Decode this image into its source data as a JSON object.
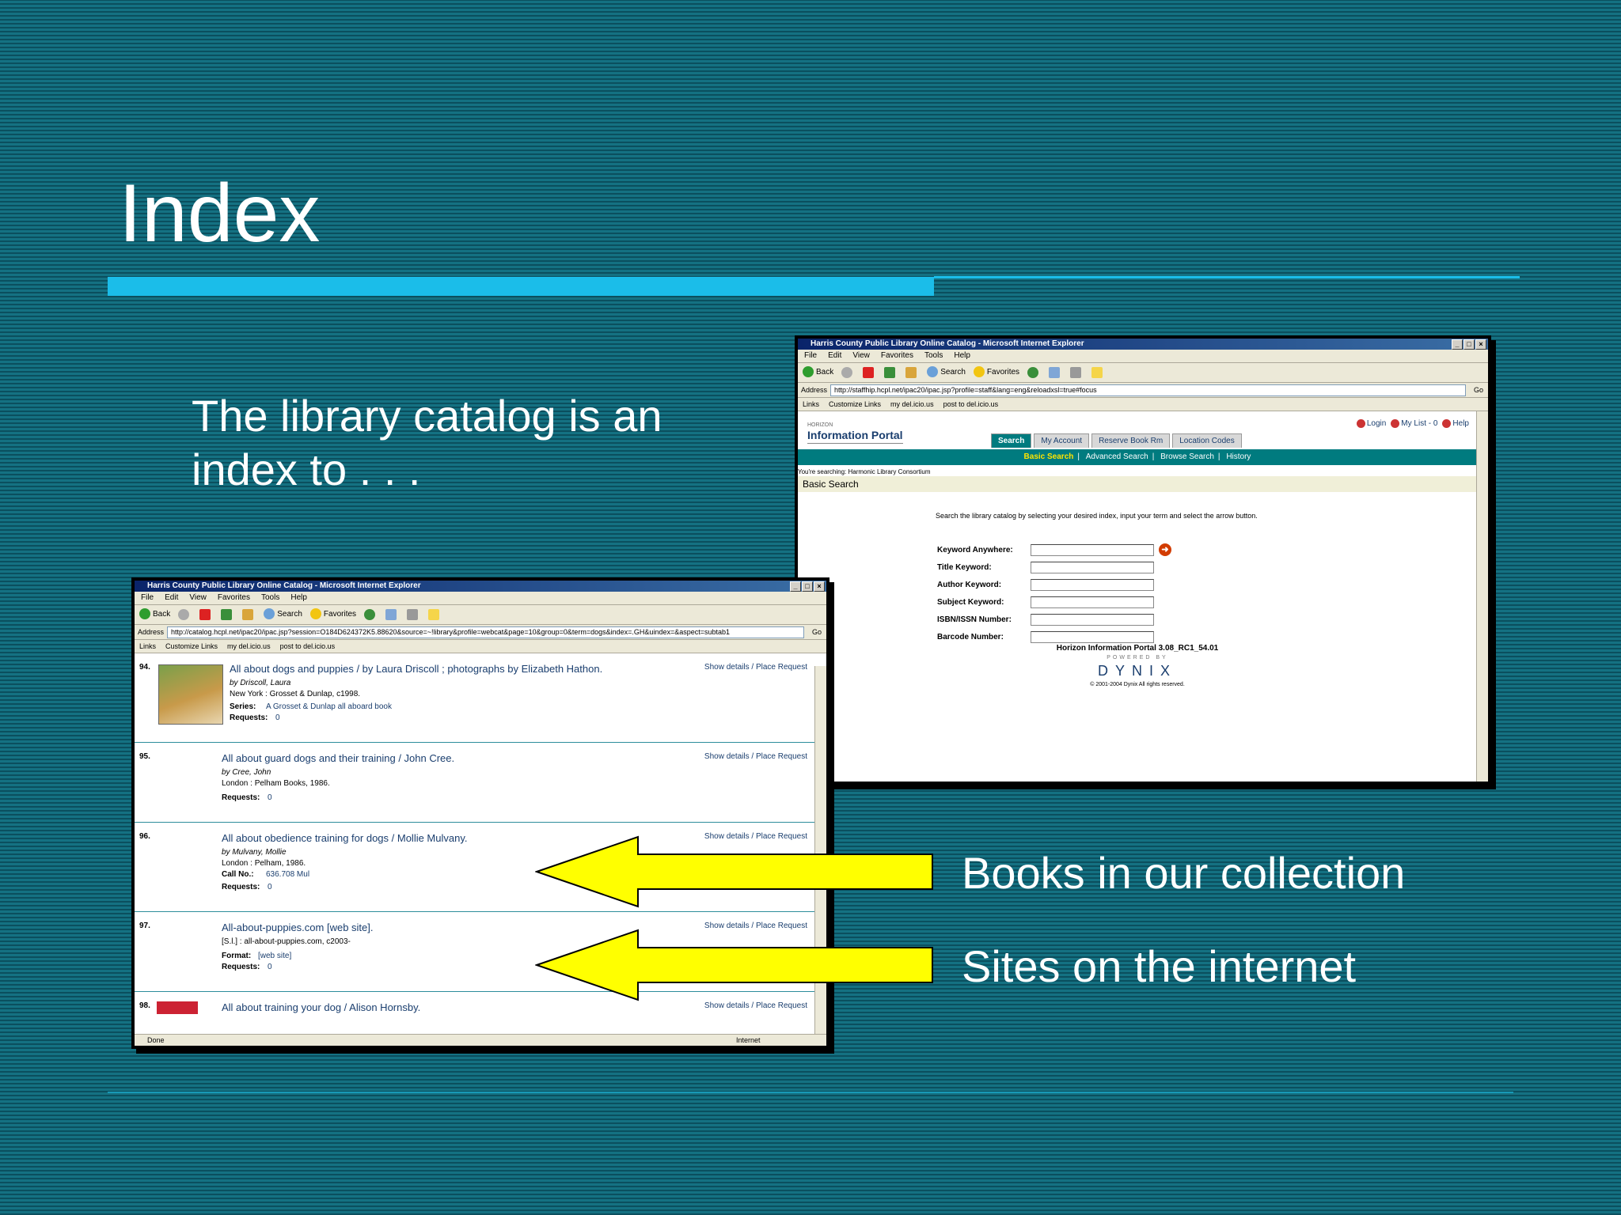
{
  "slide": {
    "title": "Index",
    "intro": "The library catalog is an index to . . .",
    "callouts": [
      "Books in our collection",
      "Sites on the internet"
    ],
    "colors": {
      "background": "#0d5b6b",
      "rule": "#1bbde9",
      "arrow": "#ffff00"
    }
  },
  "portal_window": {
    "title": "Harris County Public Library Online Catalog - Microsoft Internet Explorer",
    "menu": [
      "File",
      "Edit",
      "View",
      "Favorites",
      "Tools",
      "Help"
    ],
    "toolbar": [
      "Back",
      "Search",
      "Favorites"
    ],
    "address_label": "Address",
    "address": "http://staffhip.hcpl.net/ipac20/ipac.jsp?profile=staff&lang=eng&reloadxsl=true#focus",
    "go": "Go",
    "links_label": "Links",
    "links": [
      "Customize Links",
      "my del.icio.us",
      "post to del.icio.us"
    ],
    "logo_small": "HORIZON",
    "logo": "Information Portal",
    "top_links": [
      "Login",
      "My List - 0",
      "Help"
    ],
    "tabs": [
      "Search",
      "My Account",
      "Reserve Book Rm",
      "Location Codes"
    ],
    "subnav": [
      "Basic Search",
      "Advanced Search",
      "Browse Search",
      "History"
    ],
    "searching": "You're searching: Harmonic Library Consortium",
    "section": "Basic Search",
    "instructions": "Search the library catalog by selecting your desired index, input your term and select the arrow button.",
    "fields": [
      "Keyword Anywhere:",
      "Title Keyword:",
      "Author Keyword:",
      "Subject Keyword:",
      "ISBN/ISSN Number:",
      "Barcode Number:"
    ],
    "footer_version": "Horizon Information Portal 3.08_RC1_54.01",
    "powered": "POWERED BY",
    "brand": "DYNIX",
    "copyright": "© 2001-2004 Dynix All rights reserved."
  },
  "results_window": {
    "title": "Harris County Public Library Online Catalog - Microsoft Internet Explorer",
    "menu": [
      "File",
      "Edit",
      "View",
      "Favorites",
      "Tools",
      "Help"
    ],
    "toolbar": [
      "Back",
      "Search",
      "Favorites"
    ],
    "address_label": "Address",
    "address": "http://catalog.hcpl.net/ipac20/ipac.jsp?session=O184D624372K5.88620&source=~!library&profile=webcat&page=10&group=0&term=dogs&index=.GH&uindex=&aspect=subtab1",
    "go": "Go",
    "links_label": "Links",
    "links": [
      "Customize Links",
      "my del.icio.us",
      "post to del.icio.us"
    ],
    "actions": "Show details / Place Request",
    "status_left": "Done",
    "status_right": "Internet",
    "items": [
      {
        "num": "94.",
        "title": "All about dogs and puppies / by Laura Driscoll ; photographs by Elizabeth Hathon.",
        "by": "by Driscoll, Laura",
        "pub": "New York : Grosset & Dunlap, c1998.",
        "extra_label": "Series:",
        "extra_value": "A Grosset & Dunlap all aboard book",
        "req_label": "Requests:",
        "req_value": "0"
      },
      {
        "num": "95.",
        "title": "All about guard dogs and their training / John Cree.",
        "by": "by Cree, John",
        "pub": "London : Pelham Books, 1986.",
        "req_label": "Requests:",
        "req_value": "0"
      },
      {
        "num": "96.",
        "title": "All about obedience training for dogs / Mollie Mulvany.",
        "by": "by Mulvany, Mollie",
        "pub": "London : Pelham, 1986.",
        "extra_label": "Call No.:",
        "extra_value": "636.708 Mul",
        "req_label": "Requests:",
        "req_value": "0"
      },
      {
        "num": "97.",
        "title": "All-about-puppies.com [web site].",
        "pub": "[S.l.] : all-about-puppies.com, c2003-",
        "extra_label": "Format:",
        "extra_value": "[web site]",
        "req_label": "Requests:",
        "req_value": "0"
      },
      {
        "num": "98.",
        "title": "All about training your dog / Alison Hornsby."
      }
    ]
  }
}
